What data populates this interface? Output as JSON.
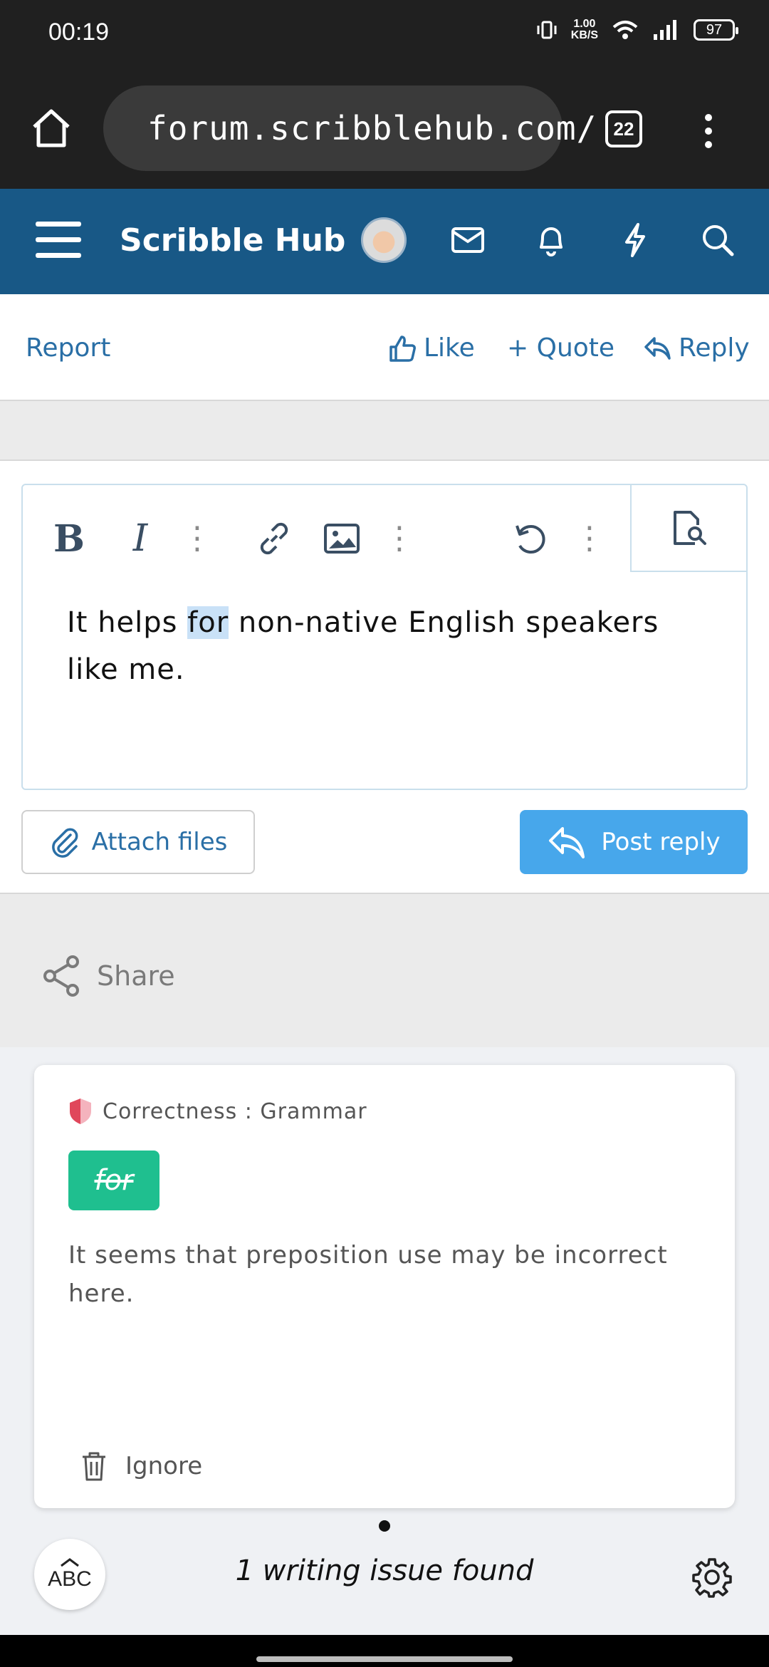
{
  "status_bar": {
    "time": "00:19",
    "net_speed_value": "1.00",
    "net_speed_unit": "KB/S",
    "battery": "97"
  },
  "browser": {
    "url": "forum.scribblehub.com/",
    "tab_count": "22"
  },
  "site": {
    "title": "Scribble Hub"
  },
  "post_actions": {
    "report": "Report",
    "like": "Like",
    "quote": "+ Quote",
    "reply": "Reply"
  },
  "editor": {
    "text_before": "It helps ",
    "text_highlight": "for",
    "text_after": " non-native English speakers like me."
  },
  "buttons": {
    "attach": "Attach files",
    "post_reply": "Post reply"
  },
  "share": {
    "label": "Share"
  },
  "grammar": {
    "category": "Correctness : Grammar",
    "suggestion": "for",
    "description": "It seems that preposition use may be incorrect here.",
    "ignore": "Ignore",
    "abc": "ABC",
    "issues_found": "1 writing issue found"
  },
  "colors": {
    "nav_bg": "#185886",
    "link": "#2a6fa6",
    "post_button": "#47a7eb",
    "chip": "#1fbf8f"
  }
}
